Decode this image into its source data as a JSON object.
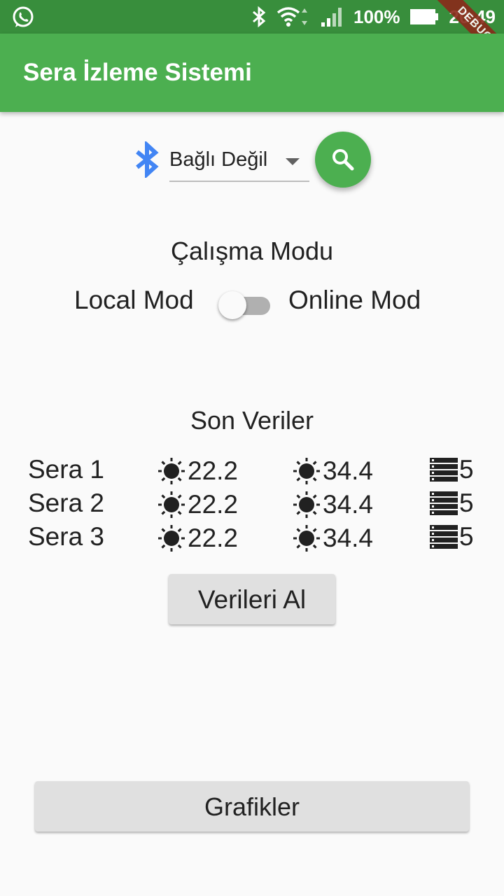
{
  "status_bar": {
    "battery": "100%",
    "time": "20:49",
    "icons": [
      "whatsapp-icon",
      "bluetooth-icon",
      "wifi-icon",
      "signal-icon",
      "battery-icon"
    ]
  },
  "debug_banner": "DEBUG",
  "app_bar": {
    "title": "Sera İzleme Sistemi"
  },
  "bluetooth": {
    "selected": "Bağlı Değil",
    "icon": "bluetooth-icon",
    "search_icon": "search-icon"
  },
  "mode": {
    "title": "Çalışma Modu",
    "local_label": "Local Mod",
    "online_label": "Online Mod",
    "online_enabled": false
  },
  "data": {
    "title": "Son Veriler",
    "rows": [
      {
        "name": "Sera 1",
        "v1": "22.2",
        "v2": "34.4",
        "v3": "5"
      },
      {
        "name": "Sera 2",
        "v1": "22.2",
        "v2": "34.4",
        "v3": "5"
      },
      {
        "name": "Sera 3",
        "v1": "22.2",
        "v2": "34.4",
        "v3": "5"
      }
    ]
  },
  "buttons": {
    "fetch": "Verileri Al",
    "graphs": "Grafikler"
  },
  "colors": {
    "status_bar": "#388e3c",
    "app_bar": "#4caf50",
    "accent": "#4caf50",
    "bluetooth": "#4285f4"
  }
}
